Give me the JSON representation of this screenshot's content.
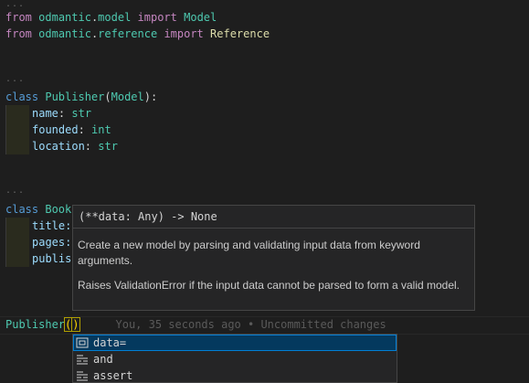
{
  "editor": {
    "imports": [
      {
        "kw_from": "from",
        "module": "odmantic",
        "dot": ".",
        "sub": "model",
        "kw_import": "import",
        "name": "Model"
      },
      {
        "kw_from": "from",
        "module": "odmantic",
        "dot": ".",
        "sub": "reference",
        "kw_import": "import",
        "name": "Reference"
      }
    ],
    "folded_marker": "...",
    "publisher_class": {
      "kw": "class",
      "name": "Publisher",
      "open": "(",
      "base": "Model",
      "close": "):",
      "fields": [
        {
          "name": "name",
          "colon": ":",
          "type": "str"
        },
        {
          "name": "founded",
          "colon": ":",
          "type": "int"
        },
        {
          "name": "location",
          "colon": ":",
          "type": "str"
        }
      ]
    },
    "book_class": {
      "kw": "class",
      "name_partial": "Book",
      "fields_partial": [
        "title:",
        "pages:",
        "publis"
      ]
    },
    "current_line": {
      "call": "Publisher",
      "open": "(",
      "close": ")",
      "blame": "You, 35 seconds ago • Uncommitted changes"
    }
  },
  "hover": {
    "signature": "(**data: Any) -> None",
    "paragraph1": "Create a new model by parsing and validating input data from keyword arguments.",
    "paragraph2": "Raises ValidationError if the input data cannot be parsed to form a valid model."
  },
  "suggest": {
    "items": [
      {
        "label": "data=",
        "icon": "variable-icon",
        "selected": true
      },
      {
        "label": "and",
        "icon": "keyword-icon",
        "selected": false
      },
      {
        "label": "assert",
        "icon": "keyword-icon",
        "selected": false
      }
    ]
  }
}
